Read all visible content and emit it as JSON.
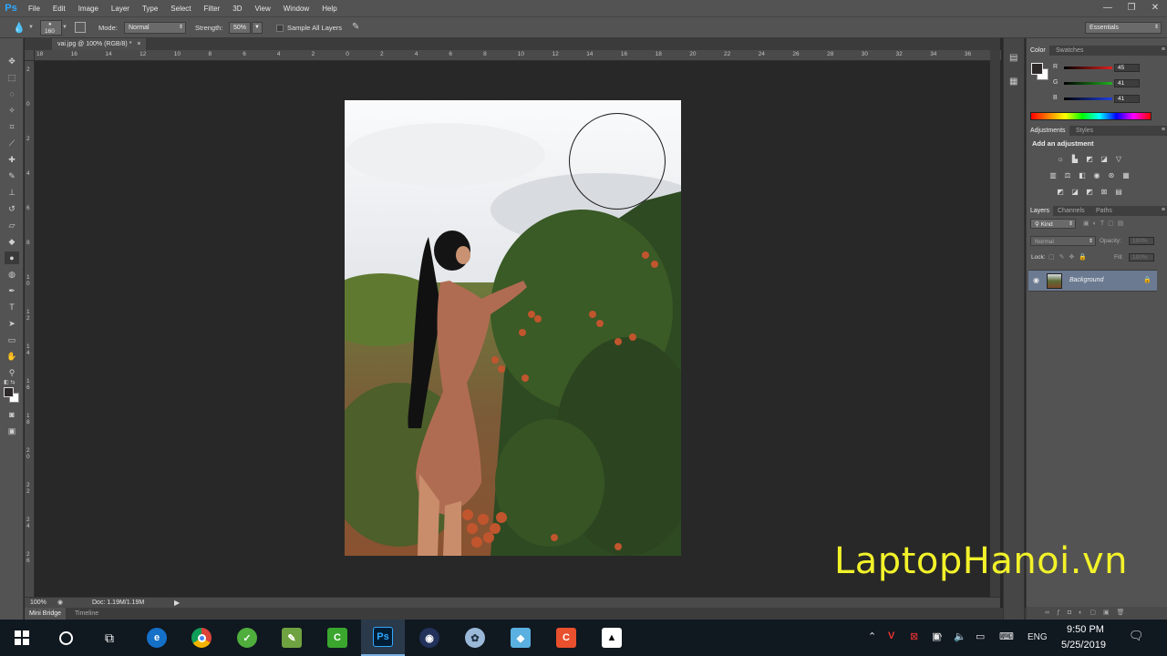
{
  "app": {
    "logo": "Ps",
    "menus": [
      "File",
      "Edit",
      "Image",
      "Layer",
      "Type",
      "Select",
      "Filter",
      "3D",
      "View",
      "Window",
      "Help"
    ]
  },
  "window_controls": [
    "—",
    "❐",
    "✕"
  ],
  "options": {
    "brush_size": "160",
    "mode_label": "Mode:",
    "mode_value": "Normal",
    "strength_label": "Strength:",
    "strength_value": "50%",
    "sample_all_layers": "Sample All Layers",
    "workspace": "Essentials"
  },
  "document": {
    "tab_title": "vai.jpg @ 100% (RGB/8) *",
    "close": "×"
  },
  "rulers": {
    "h": [
      "18",
      "16",
      "14",
      "12",
      "10",
      "8",
      "6",
      "4",
      "2",
      "0",
      "2",
      "4",
      "6",
      "8",
      "10",
      "12",
      "14",
      "16",
      "18",
      "20",
      "22",
      "24",
      "26",
      "28",
      "30",
      "32",
      "34",
      "36"
    ],
    "v": [
      "2",
      "0",
      "2",
      "4",
      "6",
      "8",
      "1 0",
      "1 2",
      "1 4",
      "1 6",
      "1 8",
      "2 0",
      "2 2",
      "2 4",
      "2 6"
    ]
  },
  "status": {
    "zoom": "100%",
    "doc": "Doc: 1.19M/1.19M"
  },
  "bottom_tabs": [
    "Mini Bridge",
    "Timeline"
  ],
  "color_panel": {
    "tabs": [
      "Color",
      "Swatches"
    ],
    "channels": [
      {
        "label": "R",
        "value": "45",
        "color": "#e02020"
      },
      {
        "label": "G",
        "value": "41",
        "color": "#20b020"
      },
      {
        "label": "B",
        "value": "41",
        "color": "#2040e0"
      }
    ]
  },
  "adjustments_panel": {
    "tabs": [
      "Adjustments",
      "Styles"
    ],
    "heading": "Add an adjustment"
  },
  "layers_panel": {
    "tabs": [
      "Layers",
      "Channels",
      "Paths"
    ],
    "kind": "Kind",
    "blend": "Normal",
    "opacity_label": "Opacity:",
    "opacity_value": "100%",
    "lock_label": "Lock:",
    "fill_label": "Fill:",
    "fill_value": "100%",
    "layers": [
      {
        "name": "Background",
        "visible": true,
        "locked": true
      }
    ]
  },
  "taskbar": {
    "apps": [
      "Start",
      "Search",
      "Task View",
      "Edge",
      "Chrome",
      "Clean Master",
      "Notepad",
      "Camtasia Rec",
      "Photoshop",
      "Webcam",
      "Paint 3D",
      "Inspector",
      "Camtasia",
      "Photos"
    ],
    "tray": {
      "lang": "ENG",
      "time": "9:50 PM",
      "date": "5/25/2019"
    }
  },
  "watermark": "LaptopHanoi.vn"
}
